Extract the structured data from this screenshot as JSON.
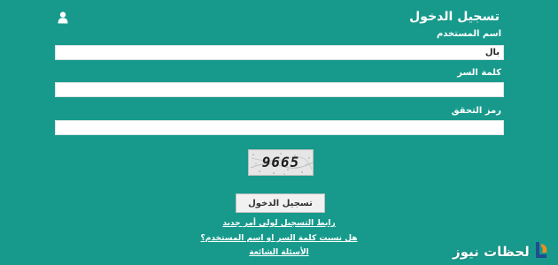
{
  "login": {
    "title": "تسجيل الدخول",
    "username_label": "اسم المستخدم",
    "username_value": "بال",
    "password_label": "كلمة السر",
    "password_value": "",
    "captcha_label": "رمز التحقق",
    "captcha_input_value": "",
    "captcha_code": "9665",
    "submit_label": "تسجيل الدخول"
  },
  "links": {
    "first_time": "رابط التسجيل لولي أمر جديد",
    "forgot": "هل نسيت كلمة السر او اسم المستخدم؟",
    "faq": "الأسئلة الشائعة"
  },
  "watermark": {
    "text": "لحظات نيوز"
  },
  "colors": {
    "background": "#179a8c",
    "text": "#ffffff"
  },
  "icons": {
    "user": "user-icon",
    "brand": "brand-logo-icon"
  }
}
